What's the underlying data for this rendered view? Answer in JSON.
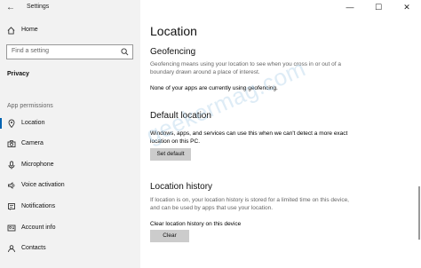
{
  "window": {
    "title": "Settings",
    "controls": {
      "minimize": "—",
      "maximize": "☐",
      "close": "✕"
    }
  },
  "sidebar": {
    "home": "Home",
    "search_placeholder": "Find a setting",
    "section_privacy": "Privacy",
    "section_app_permissions": "App permissions",
    "items": [
      {
        "label": "Location",
        "icon": "location-icon",
        "active": true
      },
      {
        "label": "Camera",
        "icon": "camera-icon",
        "active": false
      },
      {
        "label": "Microphone",
        "icon": "microphone-icon",
        "active": false
      },
      {
        "label": "Voice activation",
        "icon": "voice-activation-icon",
        "active": false
      },
      {
        "label": "Notifications",
        "icon": "notifications-icon",
        "active": false
      },
      {
        "label": "Account info",
        "icon": "account-info-icon",
        "active": false
      },
      {
        "label": "Contacts",
        "icon": "contacts-icon",
        "active": false
      }
    ]
  },
  "main": {
    "title": "Location",
    "geofencing": {
      "heading": "Geofencing",
      "description": "Geofencing means using your location to see when you cross in or out of a boundary drawn around a place of interest.",
      "status": "None of your apps are currently using geofencing."
    },
    "default_location": {
      "heading": "Default location",
      "description": "Windows, apps, and services can use this when we can't detect a more exact location on this PC.",
      "button": "Set default"
    },
    "location_history": {
      "heading": "Location history",
      "description": "If location is on, your location history is stored for a limited time on this device, and can be used by apps that use your location.",
      "clear_label": "Clear location history on this device",
      "button": "Clear"
    }
  },
  "watermark": "geekermag.com",
  "colors": {
    "accent": "#0063b1",
    "sidebar_bg": "#f2f2f2",
    "button_bg": "#cccccc"
  }
}
